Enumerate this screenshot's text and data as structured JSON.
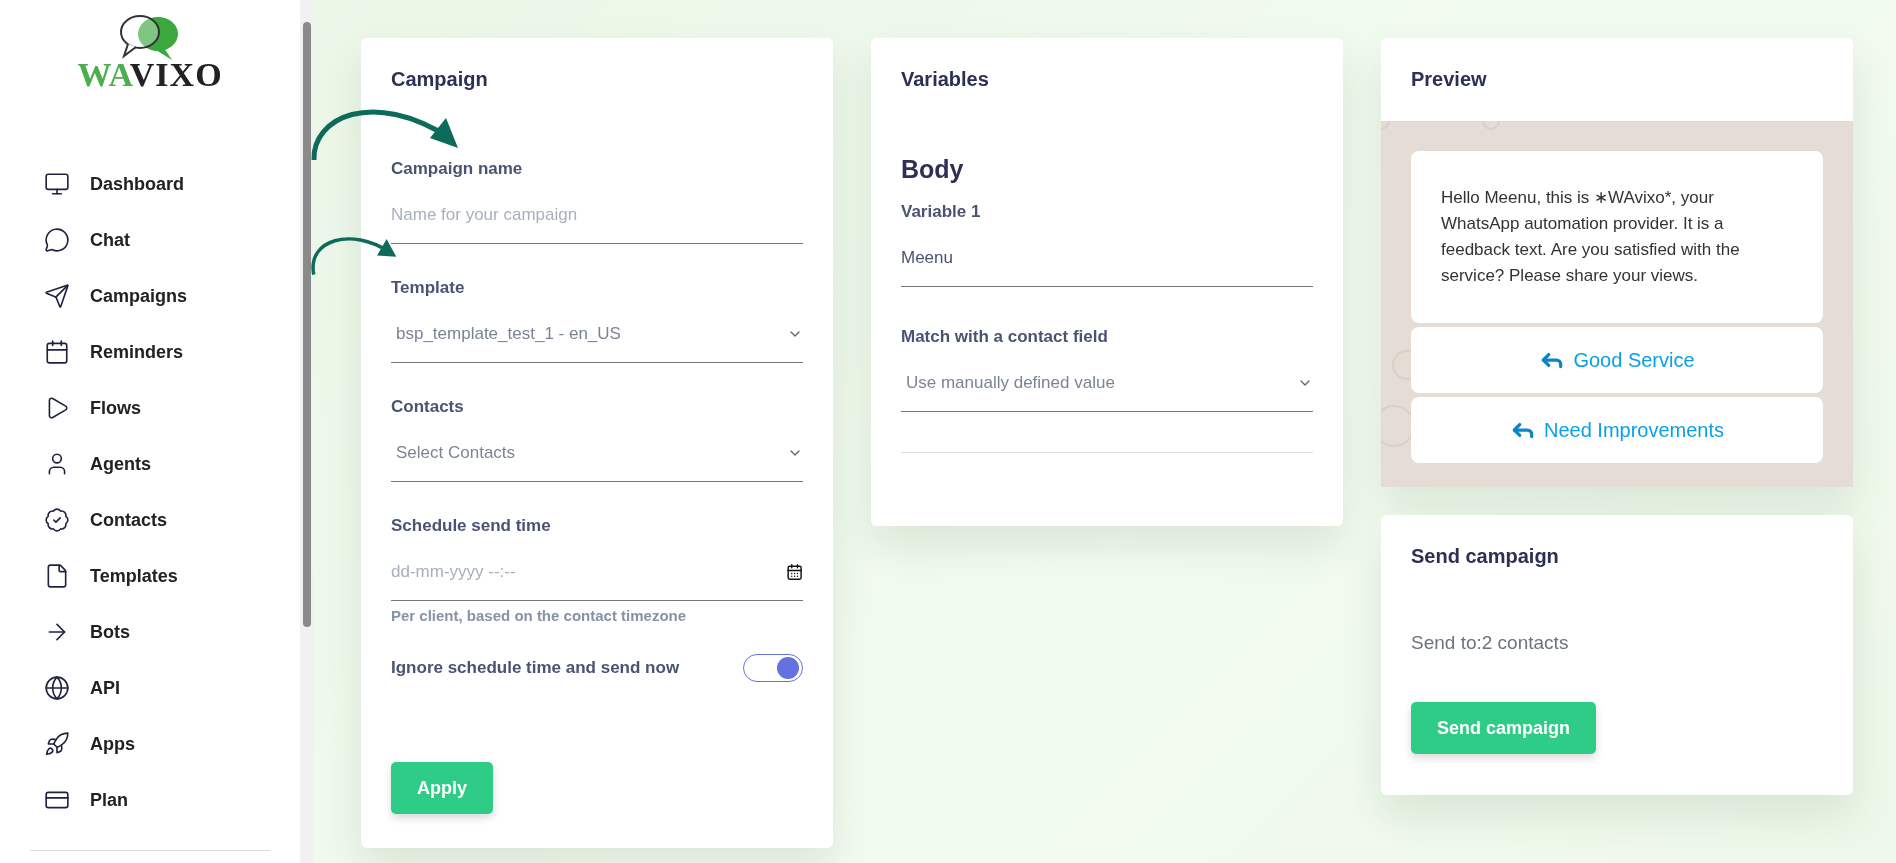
{
  "logo": {
    "text_a": "WA",
    "text_b": "VIXO"
  },
  "sidebar": {
    "items": [
      {
        "label": "Dashboard"
      },
      {
        "label": "Chat"
      },
      {
        "label": "Campaigns"
      },
      {
        "label": "Reminders"
      },
      {
        "label": "Flows"
      },
      {
        "label": "Agents"
      },
      {
        "label": "Contacts"
      },
      {
        "label": "Templates"
      },
      {
        "label": "Bots"
      },
      {
        "label": "API"
      },
      {
        "label": "Apps"
      },
      {
        "label": "Plan"
      }
    ]
  },
  "campaign": {
    "title": "Campaign",
    "fields": [
      {
        "kind": "text",
        "label": "Campaign name",
        "placeholder": "Name for your campaign"
      },
      {
        "kind": "select",
        "label": "Template",
        "value": "bsp_template_test_1 - en_US"
      },
      {
        "kind": "select",
        "label": "Contacts",
        "placeholder": "Select Contacts"
      },
      {
        "kind": "datetime",
        "label": "Schedule send time",
        "placeholder": "dd-mm-yyyy --:--",
        "hint": "Per client, based on the contact timezone"
      },
      {
        "kind": "toggle",
        "label": "Ignore schedule time and send now",
        "on": true
      }
    ],
    "button": "Apply"
  },
  "variables": {
    "title": "Variables",
    "section": "Body",
    "fields": [
      {
        "kind": "text",
        "label": "Variable 1",
        "value": "Meenu"
      },
      {
        "kind": "select",
        "label": "Match with a contact field",
        "value": "Use manually defined value"
      }
    ]
  },
  "preview": {
    "title": "Preview",
    "message": "Hello Meenu, this is ∗WAvixo*, your WhatsApp automation provider. It is a feedback text. Are you satisfied with the service? Please share your views.",
    "buttons": [
      "Good Service",
      "Need Improvements"
    ]
  },
  "send": {
    "title": "Send campaign",
    "summary": "Send to:2 contacts",
    "button": "Send campaign"
  }
}
